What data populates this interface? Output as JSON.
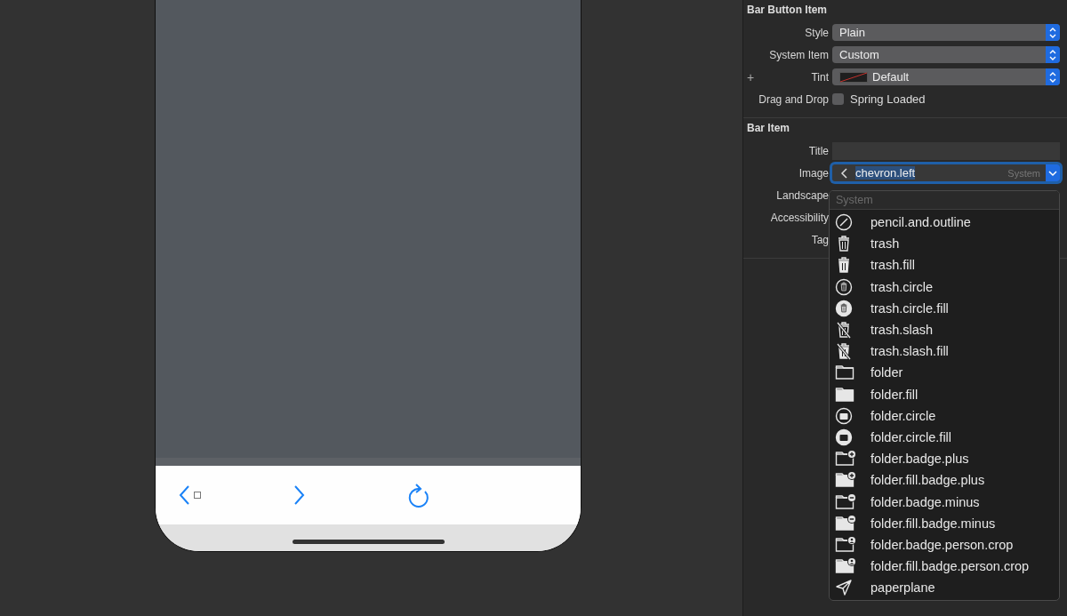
{
  "canvas": {
    "toolbar": [
      {
        "kind": "back"
      },
      {
        "kind": "forward"
      },
      {
        "kind": "reload"
      }
    ]
  },
  "inspector": {
    "sections": [
      {
        "title": "Bar Button Item",
        "rows": [
          {
            "kind": "popup",
            "label": "Style",
            "value": "Plain"
          },
          {
            "kind": "popup",
            "label": "System Item",
            "value": "Custom"
          },
          {
            "kind": "color",
            "label": "Tint",
            "value": "Default",
            "plus": "+"
          },
          {
            "kind": "checkbox",
            "label": "Drag and Drop",
            "value": "Spring Loaded",
            "checked": false
          }
        ]
      },
      {
        "title": "Bar Item",
        "rows": [
          {
            "kind": "text",
            "label": "Title"
          },
          {
            "kind": "combo",
            "label": "Image",
            "value": "chevron.left",
            "hint": "System",
            "focused": true
          },
          {
            "kind": "label",
            "label": "Landscape"
          },
          {
            "kind": "label",
            "label": "Accessibility"
          },
          {
            "kind": "label",
            "label": "Tag"
          }
        ]
      }
    ]
  },
  "dropdown": {
    "placeholder": "System",
    "items": [
      {
        "label": "pencil.and.outline",
        "kind": "pencilcircle"
      },
      {
        "label": "trash",
        "kind": "trash"
      },
      {
        "label": "trash.fill",
        "kind": "trashfill"
      },
      {
        "label": "trash.circle",
        "kind": "trashcircle"
      },
      {
        "label": "trash.circle.fill",
        "kind": "trashcirclefill"
      },
      {
        "label": "trash.slash",
        "kind": "trashslash"
      },
      {
        "label": "trash.slash.fill",
        "kind": "trashslashfill"
      },
      {
        "label": "folder",
        "kind": "folder"
      },
      {
        "label": "folder.fill",
        "kind": "folderfill"
      },
      {
        "label": "folder.circle",
        "kind": "foldercircle"
      },
      {
        "label": "folder.circle.fill",
        "kind": "foldercirclefill"
      },
      {
        "label": "folder.badge.plus",
        "kind": "folderplus"
      },
      {
        "label": "folder.fill.badge.plus",
        "kind": "folderfillplus"
      },
      {
        "label": "folder.badge.minus",
        "kind": "folderminus"
      },
      {
        "label": "folder.fill.badge.minus",
        "kind": "folderfillminus"
      },
      {
        "label": "folder.badge.person.crop",
        "kind": "folderperson"
      },
      {
        "label": "folder.fill.badge.person.crop",
        "kind": "folderfillperson"
      },
      {
        "label": "paperplane",
        "kind": "plane"
      }
    ]
  }
}
